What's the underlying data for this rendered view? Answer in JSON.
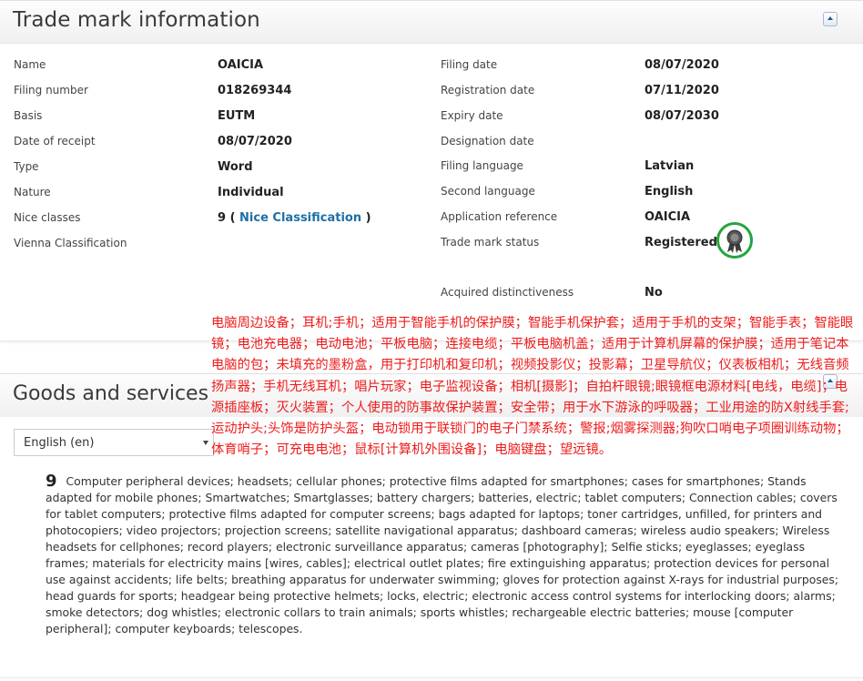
{
  "trademark_section": {
    "title": "Trade mark information",
    "left_fields": [
      {
        "label": "Name",
        "value": "OAICIA"
      },
      {
        "label": "Filing number",
        "value": "018269344"
      },
      {
        "label": "Basis",
        "value": "EUTM"
      },
      {
        "label": "Date of receipt",
        "value": "08/07/2020"
      },
      {
        "label": "Type",
        "value": "Word"
      },
      {
        "label": "Nature",
        "value": "Individual"
      },
      {
        "label": "Nice classes",
        "value_prefix": "9 ( ",
        "link": "Nice Classification",
        "value_suffix": " )"
      },
      {
        "label": "Vienna Classification",
        "value": ""
      }
    ],
    "right_fields": [
      {
        "label": "Filing date",
        "value": "08/07/2020"
      },
      {
        "label": "Registration date",
        "value": "07/11/2020"
      },
      {
        "label": "Expiry date",
        "value": "08/07/2030"
      },
      {
        "label": "Designation date",
        "value": ""
      },
      {
        "label": "Filing language",
        "value": "Latvian"
      },
      {
        "label": "Second language",
        "value": "English"
      },
      {
        "label": "Application reference",
        "value": "OAICIA"
      },
      {
        "label": "Trade mark status",
        "value": "Registered"
      },
      {
        "label": "Acquired distinctiveness",
        "value": "No"
      }
    ],
    "status_icon": "award-ribbon-icon",
    "status_icon_color": "#23a53f"
  },
  "overlay_zh": "电脑周边设备；耳机;手机；适用于智能手机的保护膜；智能手机保护套；适用于手机的支架；智能手表；智能眼镜；电池充电器；电动电池；平板电脑；连接电缆；平板电脑机盖；适用于计算机屏幕的保护膜；适用于笔记本电脑的包；未填充的墨粉盒，用于打印机和复印机；视频投影仪；投影幕；卫星导航仪；仪表板相机；无线音频扬声器；手机无线耳机；唱片玩家；电子监视设备；相机[摄影]；自拍杆眼镜;眼镜框电源材料[电线，电缆]；电源插座板；灭火装置；个人使用的防事故保护装置；安全带；用于水下游泳的呼吸器；工业用途的防X射线手套;运动护头;头饰是防护头盔；电动锁用于联锁门的电子门禁系统；警报;烟雾探测器;狗吹口哨电子项圈训练动物；体育哨子；可充电电池；鼠标[计算机外围设备]；电脑键盘；望远镜。",
  "goods_section": {
    "title": "Goods and services",
    "language_selected": "English (en)",
    "class_number": "9",
    "class_text": "Computer peripheral devices; headsets; cellular phones; protective films adapted for smartphones; cases for smartphones; Stands adapted for mobile phones; Smartwatches; Smartglasses; battery chargers; batteries, electric; tablet computers; Connection cables; covers for tablet computers; protective films adapted for computer screens; bags adapted for laptops; toner cartridges, unfilled, for printers and photocopiers; video projectors; projection screens; satellite navigational apparatus; dashboard cameras; wireless audio speakers; Wireless headsets for cellphones; record players; electronic surveillance apparatus; cameras [photography]; Selfie sticks; eyeglasses; eyeglass frames; materials for electricity mains [wires, cables]; electrical outlet plates; fire extinguishing apparatus; protection devices for personal use against accidents; life belts; breathing apparatus for underwater swimming; gloves for protection against X-rays for industrial purposes; head guards for sports; headgear being protective helmets; locks, electric; electronic access control systems for interlocking doors; alarms; smoke detectors; dog whistles; electronic collars to train animals; sports whistles; rechargeable electric batteries; mouse [computer peripheral]; computer keyboards; telescopes."
  },
  "icons": {
    "collapse": "chevron-up-icon",
    "dropdown": "chevron-down-icon"
  }
}
